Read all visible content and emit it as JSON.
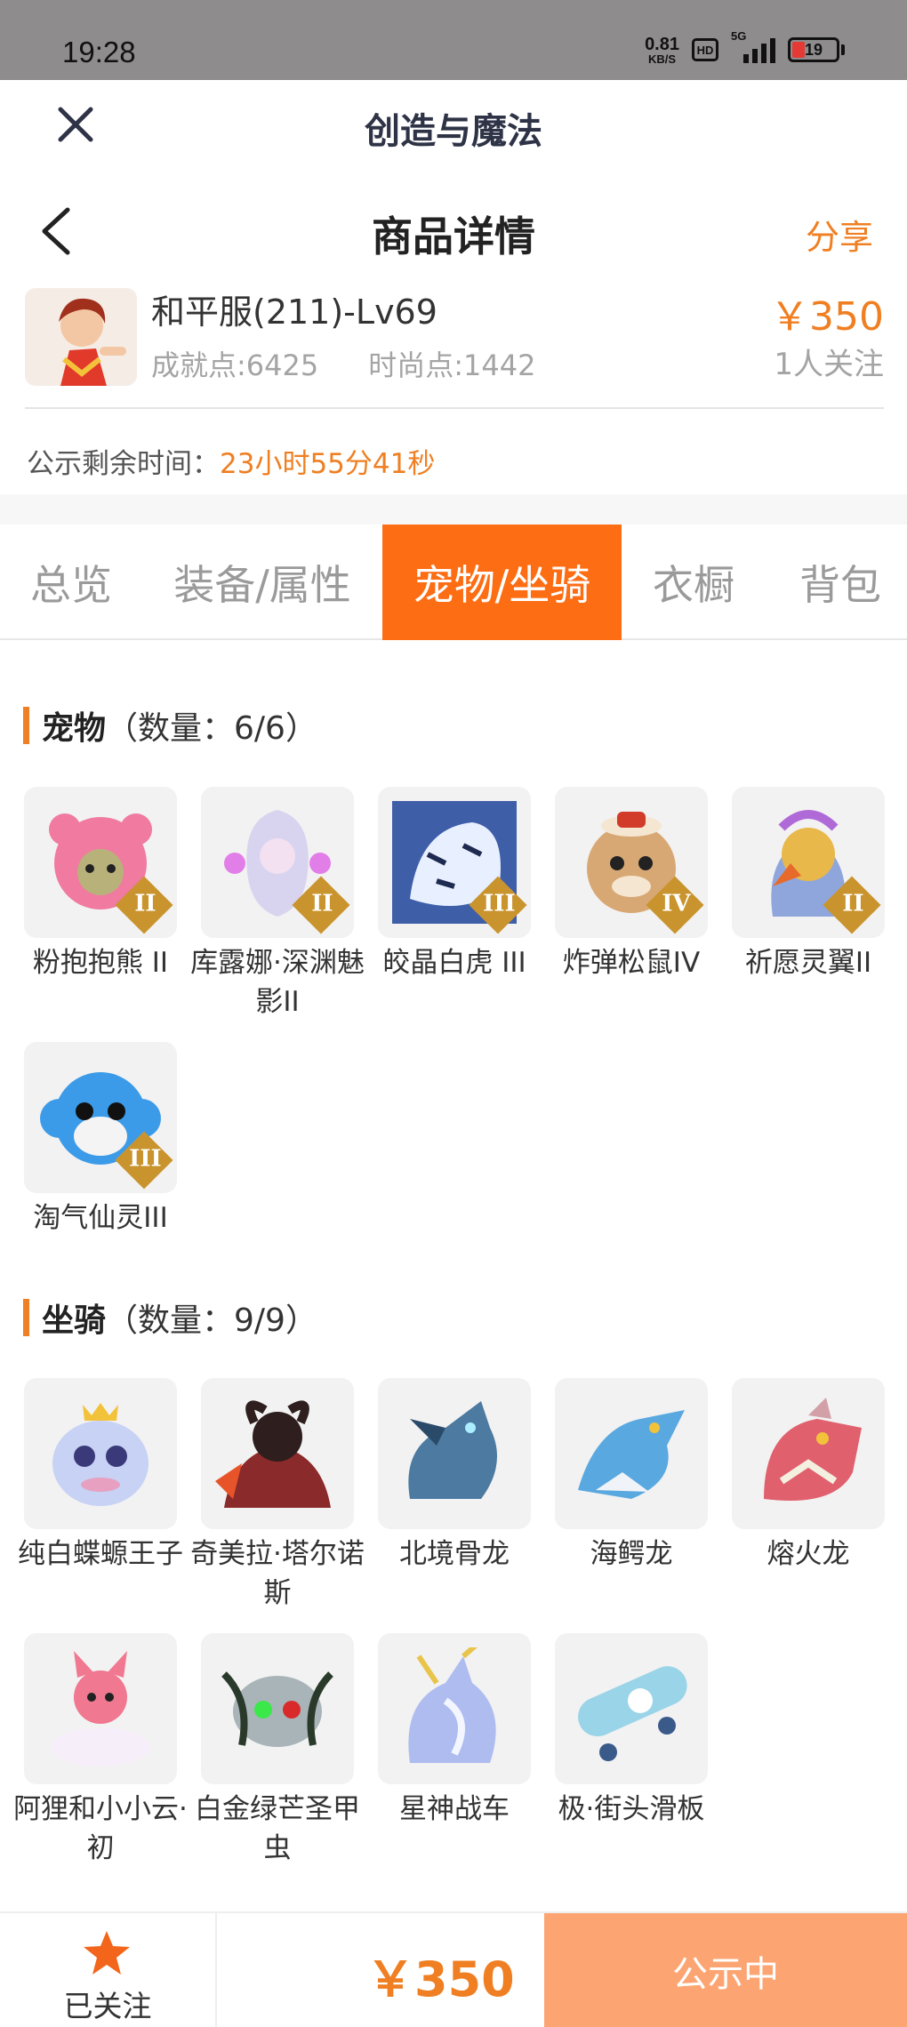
{
  "status_bar": {
    "time": "19:28",
    "speed_value": "0.81",
    "speed_unit": "KB/S",
    "hd": "HD",
    "network": "5G",
    "battery": "19"
  },
  "app": {
    "title": "创造与魔法"
  },
  "header": {
    "title": "商品详情",
    "share_label": "分享"
  },
  "product": {
    "name": "和平服(211)-Lv69",
    "achievement": "成就点:6425",
    "fashion": "时尚点:1442",
    "price": "￥350",
    "followers": "1人关注"
  },
  "countdown": {
    "label": "公示剩余时间：",
    "value": "23小时55分41秒"
  },
  "tabs": [
    {
      "label": "总览",
      "active": false
    },
    {
      "label": "装备/属性",
      "active": false
    },
    {
      "label": "宠物/坐骑",
      "active": true
    },
    {
      "label": "衣橱",
      "active": false
    },
    {
      "label": "背包",
      "active": false
    }
  ],
  "pets": {
    "title": "宠物",
    "count": "（数量：6/6）",
    "items": [
      {
        "name": "粉抱抱熊 II",
        "rank": "II",
        "color": "#f07aa0"
      },
      {
        "name": "库露娜·深渊魅影II",
        "rank": "II",
        "color": "#d8d4f0"
      },
      {
        "name": "皎晶白虎 III",
        "rank": "III",
        "color": "#5a84c8"
      },
      {
        "name": "炸弹松鼠IV",
        "rank": "IV",
        "color": "#d8a874"
      },
      {
        "name": "祈愿灵翼II",
        "rank": "II",
        "color": "#8fa6dc"
      },
      {
        "name": "淘气仙灵III",
        "rank": "III",
        "color": "#3c9be8"
      }
    ]
  },
  "mounts": {
    "title": "坐骑",
    "count": "（数量：9/9）",
    "items": [
      {
        "name": "纯白蝶螈王子",
        "color": "#c7d2f4"
      },
      {
        "name": "奇美拉·塔尔诺斯",
        "color": "#8b2a2a"
      },
      {
        "name": "北境骨龙",
        "color": "#4d7aa0"
      },
      {
        "name": "海鳄龙",
        "color": "#5aa8e0"
      },
      {
        "name": "熔火龙",
        "color": "#e0606e"
      },
      {
        "name": "阿狸和小小云·初",
        "color": "#f07890"
      },
      {
        "name": "白金绿芒圣甲虫",
        "color": "#a8b4b8"
      },
      {
        "name": "星神战车",
        "color": "#aebcf0"
      },
      {
        "name": "极·街头滑板",
        "color": "#9ad4e8"
      }
    ]
  },
  "bottom": {
    "follow_label": "已关注",
    "price": "￥350",
    "status_label": "公示中"
  },
  "colors": {
    "accent": "#ef7f22",
    "tab_active": "#fd6d14",
    "status_button": "#fca572"
  }
}
